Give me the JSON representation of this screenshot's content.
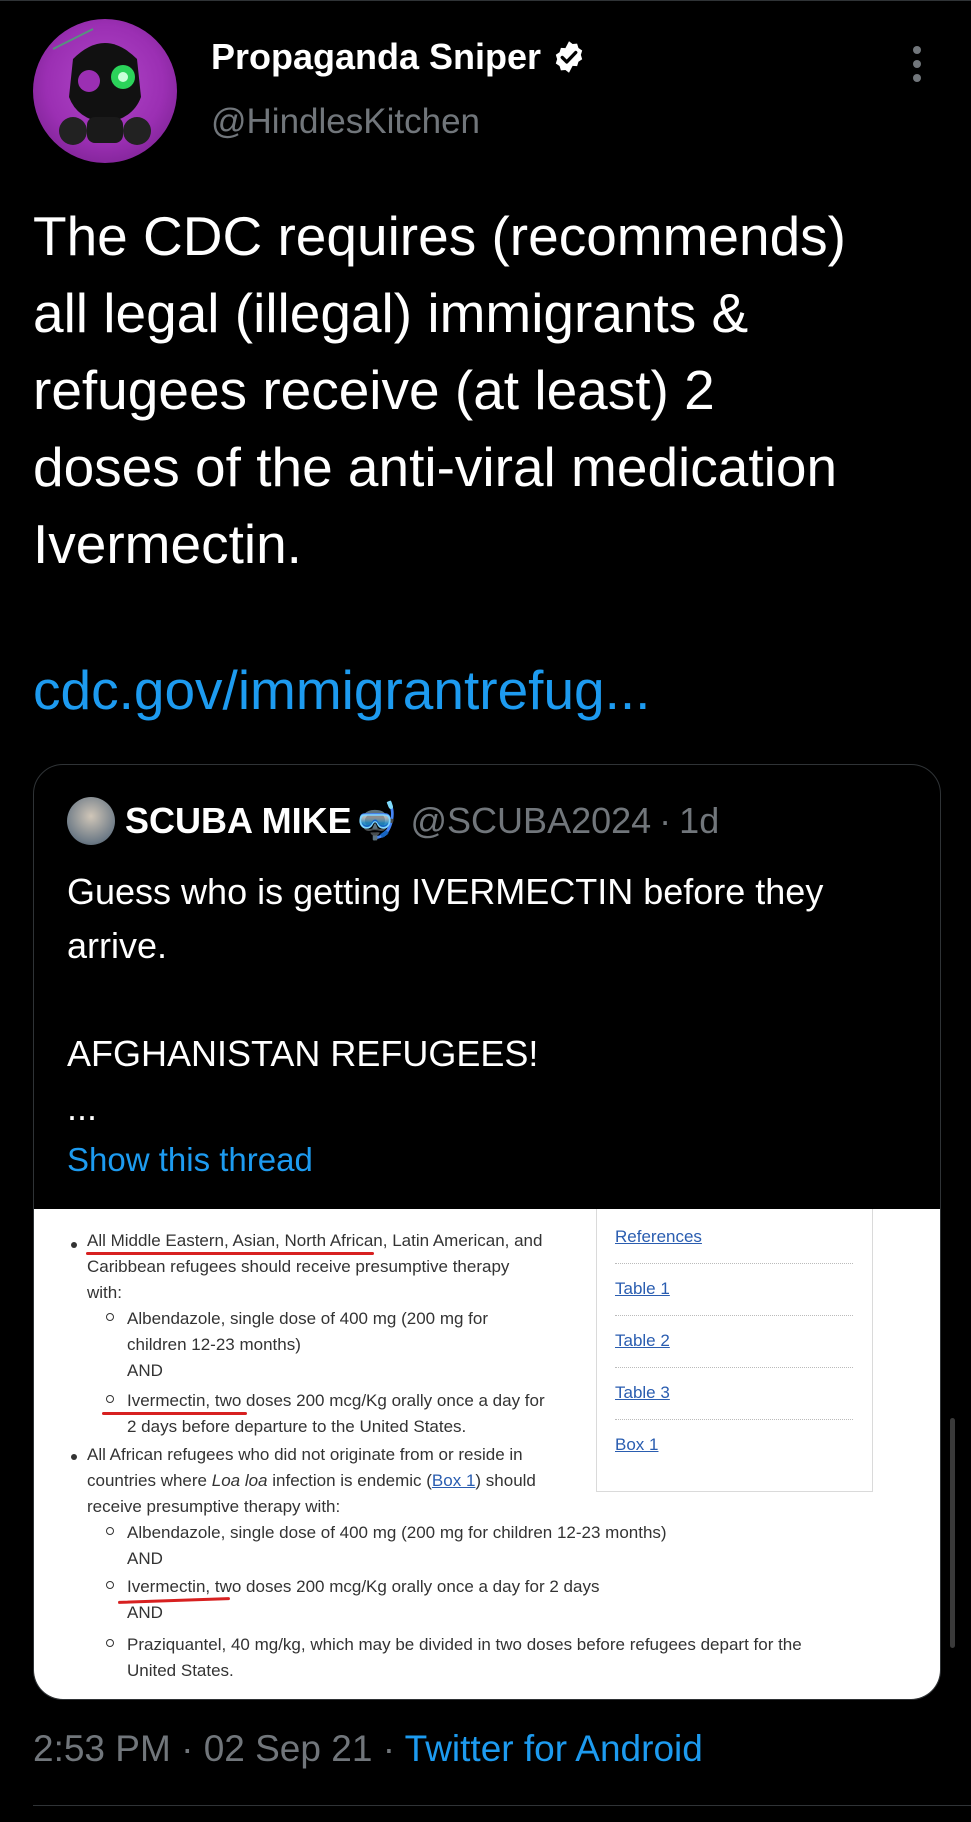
{
  "author": {
    "name": "Propaganda Sniper",
    "handle": "@HindlesKitchen",
    "verified": true,
    "avatar_color": "#9b2fb3"
  },
  "tweet": {
    "text": "The CDC requires (recommends)\nall legal (illegal) immigrants &\nrefugees receive (at least) 2\ndoses of the anti-viral medication\nIvermectin.",
    "link_text": "cdc.gov/immigrantrefug..."
  },
  "quote": {
    "name": "SCUBA MIKE",
    "emoji": "🤿",
    "handle": "@SCUBA2024",
    "separator": "·",
    "age": "1d",
    "text": "Guess who is getting IVERMECTIN before they\narrive.\n\nAFGHANISTAN REFUGEES!\n...",
    "show_thread": "Show this thread"
  },
  "document": {
    "lines": [
      "All Middle Eastern, Asian, North African, Latin American, and",
      "Caribbean refugees should receive presumptive therapy",
      "with:",
      "Albendazole, single dose of 400 mg (200 mg for",
      "children 12-23 months)",
      "AND",
      "Ivermectin, two doses 200 mcg/Kg orally once a day for",
      "2 days before departure to the United States.",
      "All African refugees who did not originate from or reside in",
      "countries where ",
      "Loa loa",
      " infection is endemic (",
      "Box 1",
      ") should",
      "receive presumptive therapy with:",
      "Albendazole, single dose of 400 mg (200 mg for children 12-23 months)",
      "AND",
      "Ivermectin, two doses 200 mcg/Kg orally once a day for 2 days",
      "AND",
      "Praziquantel, 40 mg/kg, which may be divided in two doses before refugees depart for the",
      "United States."
    ],
    "sidebar_links": [
      "References",
      "Table 1",
      "Table 2",
      "Table 3",
      "Box 1"
    ]
  },
  "footer": {
    "time": "2:53 PM",
    "date": "02 Sep 21",
    "separator": "·",
    "source": "Twitter for Android"
  },
  "colors": {
    "background": "#000000",
    "link": "#1d9bf0",
    "secondary_text": "#71767b",
    "underline_annotation": "#d72020"
  }
}
